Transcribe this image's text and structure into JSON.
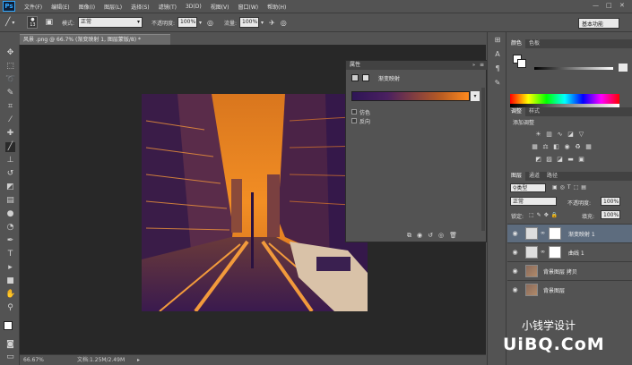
{
  "menubar": {
    "logo": "Ps",
    "items": [
      "文件(F)",
      "编辑(E)",
      "图像(I)",
      "图层(L)",
      "选择(S)",
      "滤镜(T)",
      "3D(D)",
      "视图(V)",
      "窗口(W)",
      "帮助(H)"
    ]
  },
  "options": {
    "brush_size": "13",
    "mode_label": "模式:",
    "mode_value": "正常",
    "opacity_label": "不透明度:",
    "opacity_value": "100%",
    "flow_label": "流量:",
    "flow_value": "100%",
    "workspace": "基本功能"
  },
  "document": {
    "tab_title": "风景 .png @ 66.7% (渐变映射 1, 图层蒙版/8) *"
  },
  "status": {
    "zoom": "66.67%",
    "doc_info": "文档:1.25M/2.49M"
  },
  "properties": {
    "panel_title": "属性",
    "adjust_name": "渐变映射",
    "dither_label": "仿色",
    "reverse_label": "反向"
  },
  "panels": {
    "color_tab": "颜色",
    "swatches_tab": "色板",
    "adjust_tab": "调整",
    "styles_tab": "样式",
    "add_adjust": "添加调整",
    "layers_tab": "图层",
    "channels_tab": "通道",
    "paths_tab": "路径",
    "kind_filter": "类型",
    "blend_mode": "正常",
    "opacity_label": "不透明度:",
    "opacity_value": "100%",
    "lock_label": "锁定:",
    "fill_label": "填充:",
    "fill_value": "100%"
  },
  "layers": [
    {
      "name": "渐变映射 1",
      "active": true
    },
    {
      "name": "曲线 1",
      "active": false
    },
    {
      "name": "背景图层 拷贝",
      "active": false
    },
    {
      "name": "背景图层",
      "active": false
    }
  ],
  "watermark": {
    "line1": "小钱学设计",
    "line2": "UiBQ.CoM"
  },
  "colors": {
    "accent": "#31a8ff",
    "gradient_start": "#2e1556",
    "gradient_end": "#ff8a1d"
  }
}
